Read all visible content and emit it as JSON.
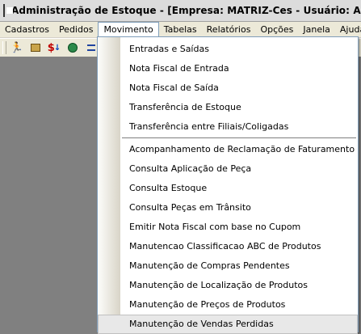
{
  "window": {
    "title": "Administração de Estoque - [Empresa: MATRIZ-Ces - Usuário: ACAO Inf"
  },
  "menubar": {
    "items": [
      "Cadastros",
      "Pedidos",
      "Movimento",
      "Tabelas",
      "Relatórios",
      "Opções",
      "Janela",
      "Ajuda"
    ],
    "active": "Movimento"
  },
  "toolbar": {
    "icons": [
      "run-icon",
      "box-icon",
      "money-icon",
      "globe-icon",
      "list-icon"
    ],
    "money_symbol": "$",
    "money_arrow": "↓"
  },
  "movimento_menu": {
    "group1": [
      "Entradas e Saídas",
      "Nota Fiscal de Entrada",
      "Nota Fiscal de Saída",
      "Transferência de Estoque",
      "Transferência entre Filiais/Coligadas"
    ],
    "group2": [
      "Acompanhamento de Reclamação de Faturamento",
      "Consulta Aplicação de Peça",
      "Consulta Estoque",
      "Consulta Peças em Trânsito",
      "Emitir Nota Fiscal com base no Cupom",
      "Manutencao Classificacao ABC de Produtos",
      "Manutenção de Compras Pendentes",
      "Manutenção de Localização de Produtos",
      "Manutenção de Preços de Produtos",
      "Manutenção de Vendas Perdidas"
    ],
    "highlighted": "Manutenção de Vendas Perdidas"
  }
}
